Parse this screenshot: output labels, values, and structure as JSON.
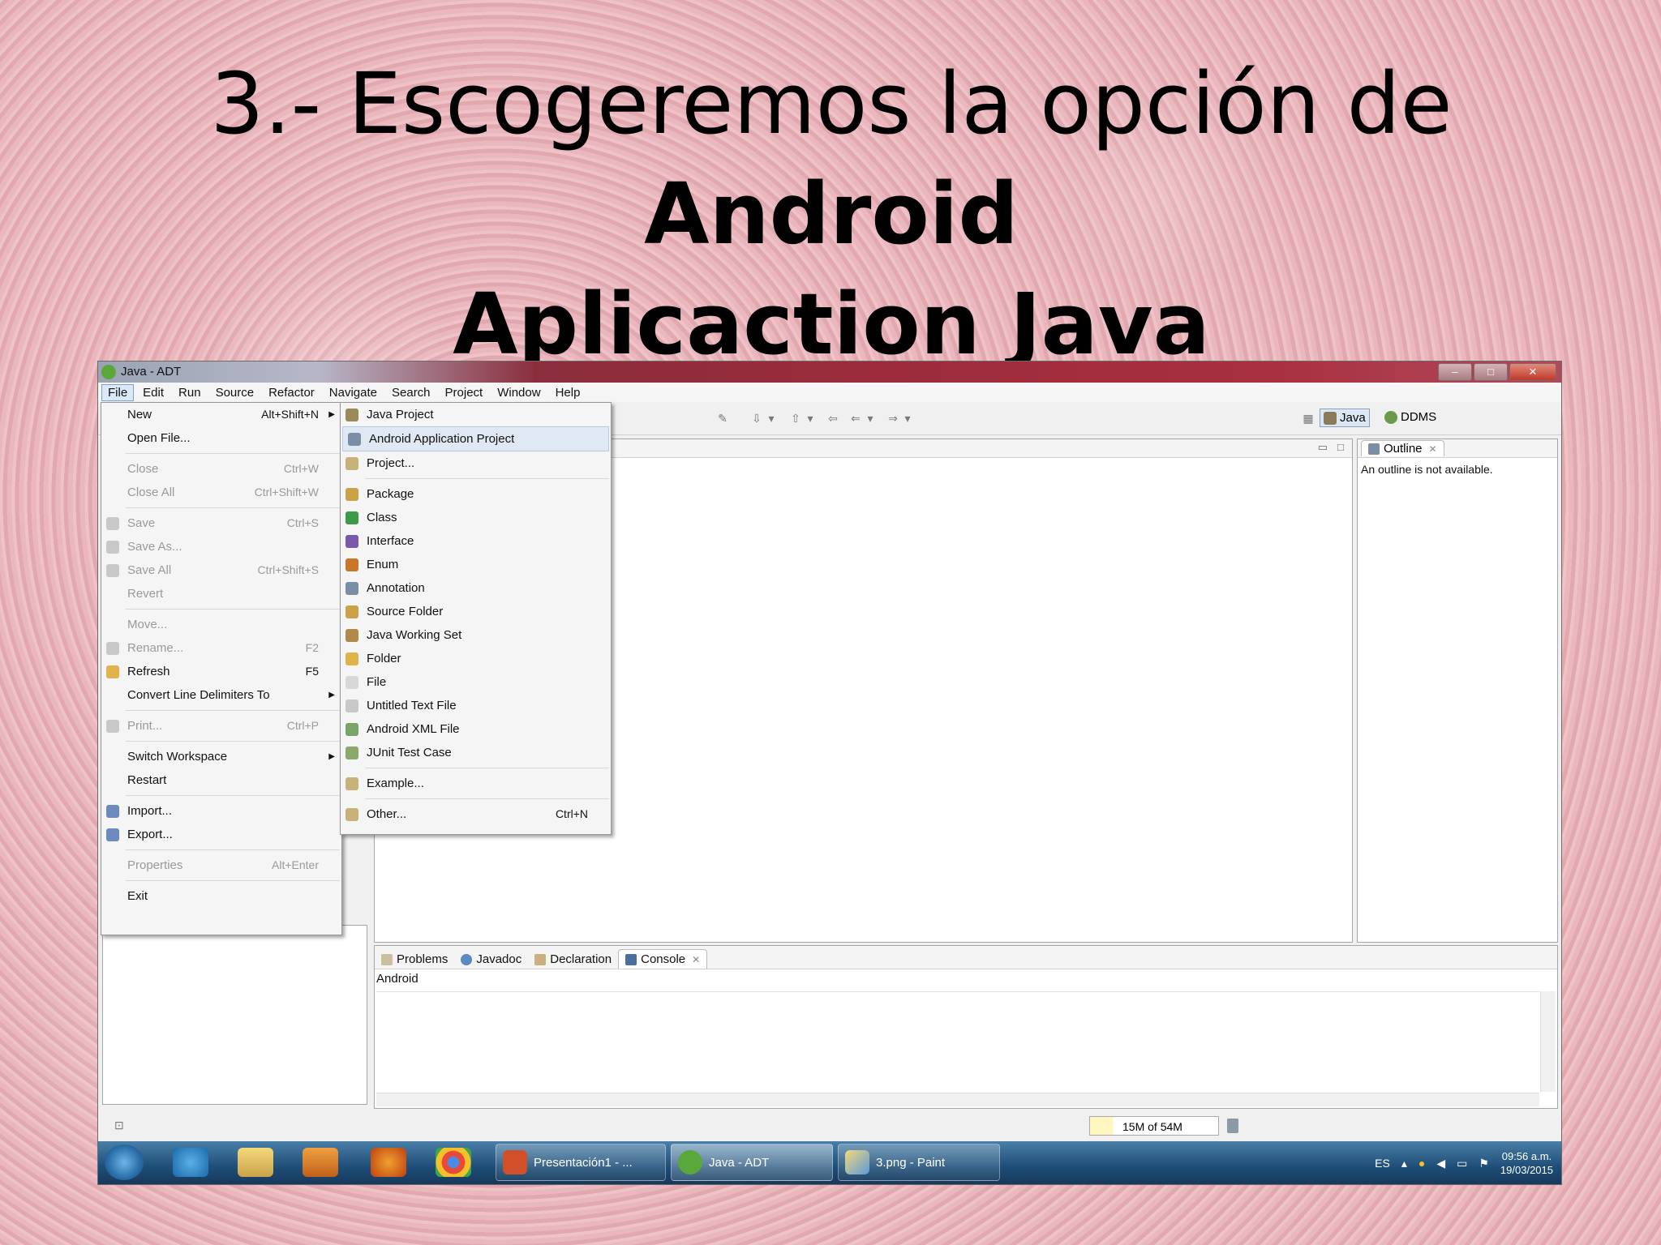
{
  "slide": {
    "title_plain": "3.- Escogeremos la opción de ",
    "title_bold_line1": "Android",
    "title_bold_line2": "Aplicaction Java"
  },
  "window": {
    "title": "Java - ADT",
    "menubar": [
      "File",
      "Edit",
      "Run",
      "Source",
      "Refactor",
      "Navigate",
      "Search",
      "Project",
      "Window",
      "Help"
    ],
    "perspectives": [
      "Java",
      "DDMS"
    ],
    "outline": {
      "tab": "Outline",
      "message": "An outline is not available."
    },
    "console": {
      "tabs": [
        "Problems",
        "Javadoc",
        "Declaration",
        "Console"
      ],
      "label": "Android"
    },
    "status": {
      "heap": "15M of 54M"
    }
  },
  "file_menu": [
    {
      "label": "New",
      "shortcut": "Alt+Shift+N",
      "submenu": true,
      "enabled": true
    },
    {
      "label": "Open File...",
      "shortcut": "",
      "enabled": true
    },
    {
      "sep": true
    },
    {
      "label": "Close",
      "shortcut": "Ctrl+W",
      "enabled": false
    },
    {
      "label": "Close All",
      "shortcut": "Ctrl+Shift+W",
      "enabled": false
    },
    {
      "sep": true
    },
    {
      "label": "Save",
      "shortcut": "Ctrl+S",
      "enabled": false
    },
    {
      "label": "Save As...",
      "shortcut": "",
      "enabled": false
    },
    {
      "label": "Save All",
      "shortcut": "Ctrl+Shift+S",
      "enabled": false
    },
    {
      "label": "Revert",
      "shortcut": "",
      "enabled": false
    },
    {
      "sep": true
    },
    {
      "label": "Move...",
      "shortcut": "",
      "enabled": false
    },
    {
      "label": "Rename...",
      "shortcut": "F2",
      "enabled": false
    },
    {
      "label": "Refresh",
      "shortcut": "F5",
      "enabled": true
    },
    {
      "label": "Convert Line Delimiters To",
      "shortcut": "",
      "submenu": true,
      "enabled": true
    },
    {
      "sep": true
    },
    {
      "label": "Print...",
      "shortcut": "Ctrl+P",
      "enabled": false
    },
    {
      "sep": true
    },
    {
      "label": "Switch Workspace",
      "shortcut": "",
      "submenu": true,
      "enabled": true
    },
    {
      "label": "Restart",
      "shortcut": "",
      "enabled": true
    },
    {
      "sep": true
    },
    {
      "label": "Import...",
      "shortcut": "",
      "enabled": true
    },
    {
      "label": "Export...",
      "shortcut": "",
      "enabled": true
    },
    {
      "sep": true
    },
    {
      "label": "Properties",
      "shortcut": "Alt+Enter",
      "enabled": false
    },
    {
      "sep": true
    },
    {
      "label": "Exit",
      "shortcut": "",
      "enabled": true
    }
  ],
  "new_menu": [
    {
      "label": "Java Project",
      "shortcut": "",
      "icon_color": "#9b8a5a"
    },
    {
      "label": "Android Application Project",
      "shortcut": "",
      "icon_color": "#7a8fa5",
      "highlighted": true
    },
    {
      "label": "Project...",
      "shortcut": "",
      "icon_color": "#c9b27a"
    },
    {
      "sep": true
    },
    {
      "label": "Package",
      "shortcut": "",
      "icon_color": "#c9a24a"
    },
    {
      "label": "Class",
      "shortcut": "",
      "icon_color": "#3c9a4a"
    },
    {
      "label": "Interface",
      "shortcut": "",
      "icon_color": "#7a5aa8"
    },
    {
      "label": "Enum",
      "shortcut": "",
      "icon_color": "#c9762a"
    },
    {
      "label": "Annotation",
      "shortcut": "",
      "icon_color": "#7a8fa5"
    },
    {
      "label": "Source Folder",
      "shortcut": "",
      "icon_color": "#c9a24a"
    },
    {
      "label": "Java Working Set",
      "shortcut": "",
      "icon_color": "#b08a4a"
    },
    {
      "label": "Folder",
      "shortcut": "",
      "icon_color": "#e0b44a"
    },
    {
      "label": "File",
      "shortcut": "",
      "icon_color": "#d8d8d8"
    },
    {
      "label": "Untitled Text File",
      "shortcut": "",
      "icon_color": "#c8c8c8"
    },
    {
      "label": "Android XML File",
      "shortcut": "",
      "icon_color": "#7aa56a"
    },
    {
      "label": "JUnit Test Case",
      "shortcut": "",
      "icon_color": "#8aaa6a"
    },
    {
      "sep": true
    },
    {
      "label": "Example...",
      "shortcut": "",
      "icon_color": "#c9b27a"
    },
    {
      "sep": true
    },
    {
      "label": "Other...",
      "shortcut": "Ctrl+N",
      "icon_color": "#c9b27a"
    }
  ],
  "taskbar": {
    "tasks": [
      "Presentación1 - ...",
      "Java - ADT",
      "3.png - Paint"
    ],
    "lang": "ES",
    "time": "09:56 a.m.",
    "date": "19/03/2015"
  },
  "colors": {
    "slide_bg": "#e4afb6",
    "menu_highlight": "#dfe8f3",
    "taskbar": "#1e4e78"
  }
}
